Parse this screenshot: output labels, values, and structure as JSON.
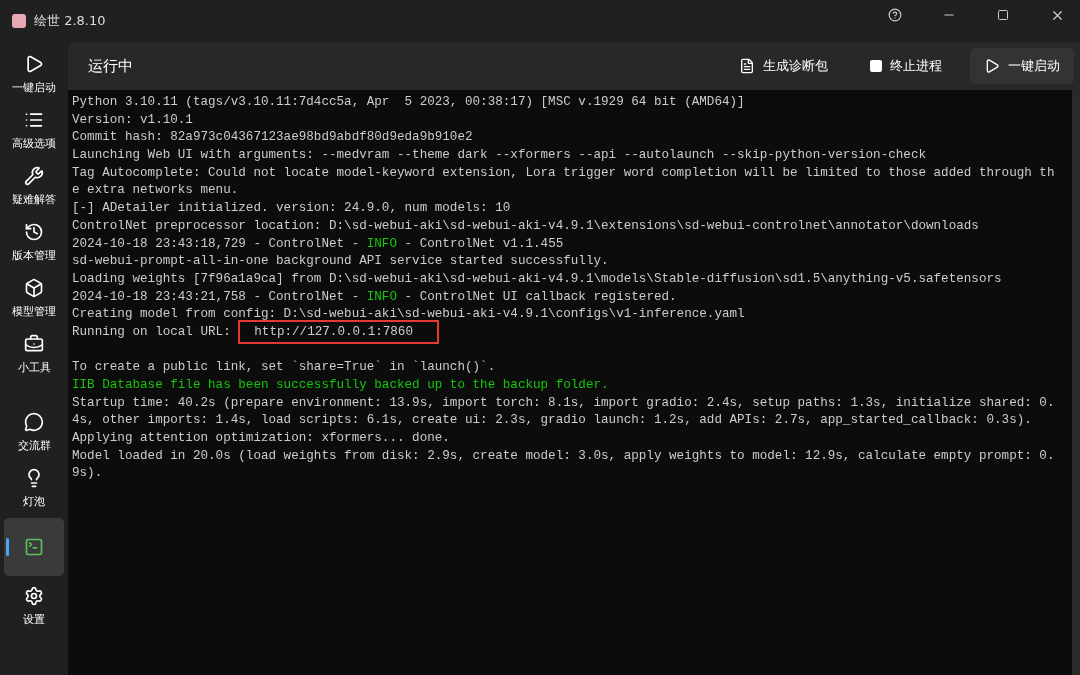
{
  "window": {
    "title": "绘世 2.8.10"
  },
  "sidebar": {
    "items": [
      {
        "label": "一键启动",
        "selected": false
      },
      {
        "label": "高级选项",
        "selected": false
      },
      {
        "label": "疑难解答",
        "selected": false
      },
      {
        "label": "版本管理",
        "selected": false
      },
      {
        "label": "模型管理",
        "selected": false
      },
      {
        "label": "小工具",
        "selected": false
      },
      {
        "label": "交流群",
        "selected": false
      },
      {
        "label": "灯泡",
        "selected": false
      },
      {
        "selected": true
      },
      {
        "label": "设置",
        "selected": false
      }
    ]
  },
  "header": {
    "title": "运行中",
    "actions": [
      {
        "kind": "button",
        "label": "生成诊断包"
      },
      {
        "kind": "checkbox",
        "label": "终止进程",
        "checked": false
      },
      {
        "kind": "primary",
        "label": "一键启动"
      }
    ]
  },
  "console": {
    "lines": [
      {
        "parts": [
          {
            "kind": "plain",
            "text": "Python 3.10.11 (tags/v3.10.11:7d4cc5a, Apr  5 2023, 00:38:17) [MSC v.1929 64 bit (AMD64)]"
          }
        ]
      },
      {
        "parts": [
          {
            "kind": "plain",
            "text": "Version: v1.10.1"
          }
        ]
      },
      {
        "parts": [
          {
            "kind": "plain",
            "text": "Commit hash: 82a973c04367123ae98bd9abdf80d9eda9b910e2"
          }
        ]
      },
      {
        "parts": [
          {
            "kind": "plain",
            "text": "Launching Web UI with arguments: --medvram --theme dark --xformers --api --autolaunch --skip-python-version-check"
          }
        ]
      },
      {
        "parts": [
          {
            "kind": "plain",
            "text": "Tag Autocomplete: Could not locate model-keyword extension, Lora trigger word completion will be limited to those added through th"
          }
        ]
      },
      {
        "parts": [
          {
            "kind": "plain",
            "text": "e extra networks menu."
          }
        ]
      },
      {
        "parts": [
          {
            "kind": "plain",
            "text": "[-] ADetailer initialized. version: 24.9.0, num models: 10"
          }
        ]
      },
      {
        "parts": [
          {
            "kind": "plain",
            "text": "ControlNet preprocessor location: D:\\sd-webui-aki\\sd-webui-aki-v4.9.1\\extensions\\sd-webui-controlnet\\annotator\\downloads"
          }
        ]
      },
      {
        "parts": [
          {
            "kind": "plain",
            "text": "2024-10-18 23:43:18,729 - ControlNet - "
          },
          {
            "kind": "info",
            "text": "INFO"
          },
          {
            "kind": "plain",
            "text": " - ControlNet v1.1.455"
          }
        ]
      },
      {
        "parts": [
          {
            "kind": "plain",
            "text": "sd-webui-prompt-all-in-one background API service started successfully."
          }
        ]
      },
      {
        "parts": [
          {
            "kind": "plain",
            "text": "Loading weights [7f96a1a9ca] from D:\\sd-webui-aki\\sd-webui-aki-v4.9.1\\models\\Stable-diffusion\\sd1.5\\anything-v5.safetensors"
          }
        ]
      },
      {
        "parts": [
          {
            "kind": "plain",
            "text": "2024-10-18 23:43:21,758 - ControlNet - "
          },
          {
            "kind": "info",
            "text": "INFO"
          },
          {
            "kind": "plain",
            "text": " - ControlNet UI callback registered."
          }
        ]
      },
      {
        "parts": [
          {
            "kind": "plain",
            "text": "Creating model from config: D:\\sd-webui-aki\\sd-webui-aki-v4.9.1\\configs\\v1-inference.yaml"
          }
        ]
      },
      {
        "parts": [
          {
            "kind": "plain",
            "text": "Running on local URL: "
          },
          {
            "kind": "boxed",
            "text": "http://127.0.0.1:7860"
          }
        ]
      },
      {
        "kind": "blank"
      },
      {
        "parts": [
          {
            "kind": "plain",
            "text": "To create a public link, set `share=True` in `launch()`."
          }
        ]
      },
      {
        "parts": [
          {
            "kind": "info",
            "text": "IIB Database file has been successfully backed up to the backup folder."
          }
        ]
      },
      {
        "parts": [
          {
            "kind": "plain",
            "text": "Startup time: 40.2s (prepare environment: 13.9s, import torch: 8.1s, import gradio: 2.4s, setup paths: 1.3s, initialize shared: 0."
          }
        ]
      },
      {
        "parts": [
          {
            "kind": "plain",
            "text": "4s, other imports: 1.4s, load scripts: 6.1s, create ui: 2.3s, gradio launch: 1.2s, add APIs: 2.7s, app_started_callback: 0.3s)."
          }
        ]
      },
      {
        "parts": [
          {
            "kind": "plain",
            "text": "Applying attention optimization: xformers... done."
          }
        ]
      },
      {
        "parts": [
          {
            "kind": "plain",
            "text": "Model loaded in 20.0s (load weights from disk: 2.9s, create model: 3.0s, apply weights to model: 12.9s, calculate empty prompt: 0."
          }
        ]
      },
      {
        "parts": [
          {
            "kind": "plain",
            "text": "9s)."
          }
        ]
      }
    ]
  }
}
